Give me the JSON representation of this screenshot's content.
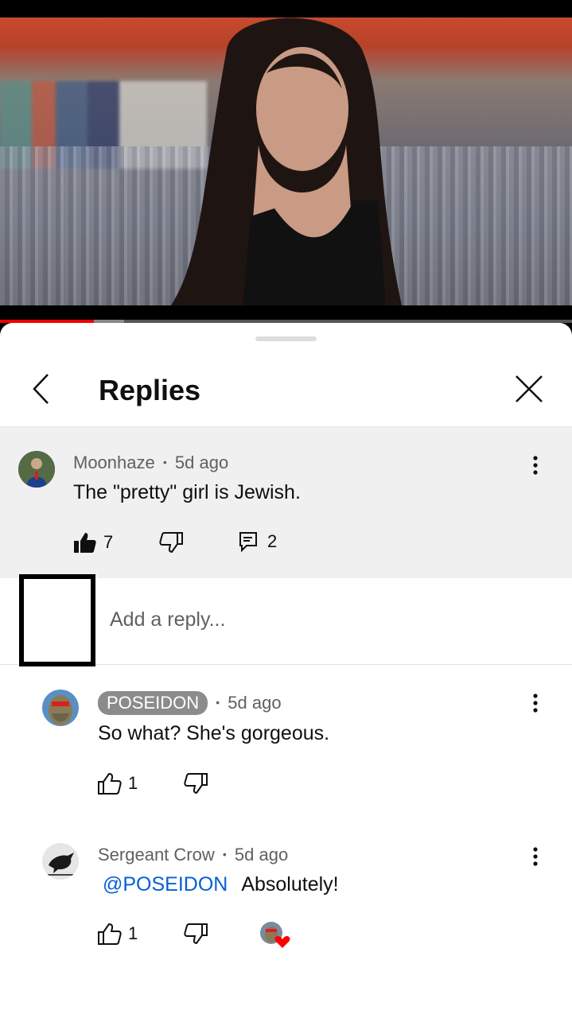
{
  "sheet": {
    "title": "Replies"
  },
  "parent_comment": {
    "author": "Moonhaze",
    "time": "5d ago",
    "text": "The \"pretty\" girl is Jewish.",
    "likes": "7",
    "replies": "2"
  },
  "reply_input": {
    "placeholder": "Add a reply..."
  },
  "replies": [
    {
      "author": "POSEIDON",
      "time": "5d ago",
      "text": "So what? She's gorgeous.",
      "likes": "1"
    },
    {
      "author": "Sergeant Crow",
      "time": "5d ago",
      "mention": "@POSEIDON",
      "text": "Absolutely!",
      "likes": "1"
    }
  ],
  "meta_separator": "•",
  "colors": {
    "accent_red": "#ff0000",
    "mention_blue": "#065fd4",
    "badge_gray": "#8b8b8b"
  }
}
